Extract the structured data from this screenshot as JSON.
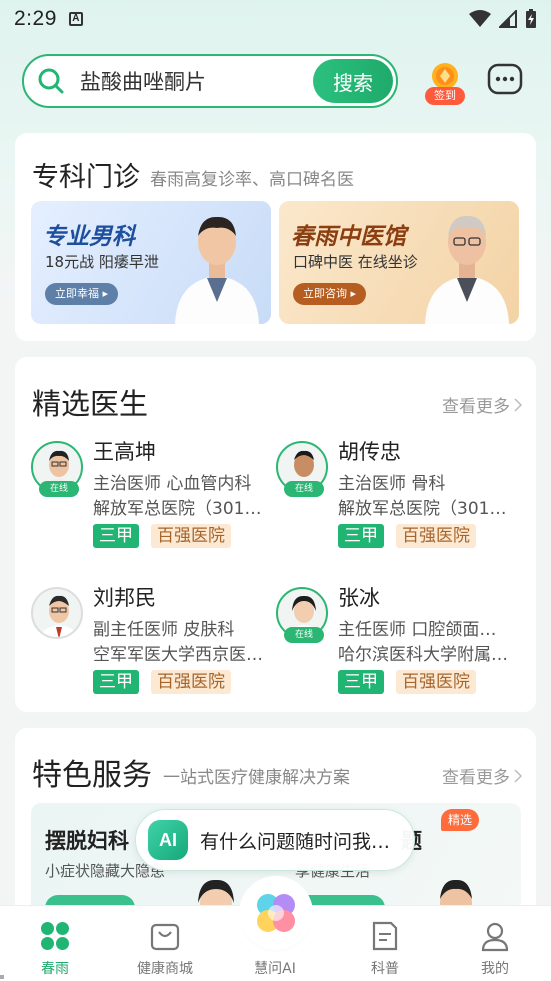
{
  "status_bar": {
    "time": "2:29"
  },
  "search": {
    "query": "盐酸曲唑酮片",
    "button_label": "搜索"
  },
  "header": {
    "checkin_label": "签到"
  },
  "specialty": {
    "title": "专科门诊",
    "subtitle": "春雨高复诊率、高口碑名医",
    "banners": [
      {
        "title": "专业男科",
        "subtitle": "18元战 阳痿早泄",
        "button": "立即幸福 ▸"
      },
      {
        "title": "春雨中医馆",
        "subtitle": "口碑中医 在线坐诊",
        "button": "立即咨询 ▸"
      }
    ]
  },
  "doctors": {
    "title": "精选医生",
    "more_label": "查看更多",
    "online_label": "在线",
    "list": [
      {
        "name": "王高坤",
        "title": "主治医师 心血管内科",
        "hospital": "解放军总医院（301…",
        "tag1": "三甲",
        "tag2": "百强医院",
        "online": true
      },
      {
        "name": "胡传忠",
        "title": "主治医师 骨科",
        "hospital": "解放军总医院（301…",
        "tag1": "三甲",
        "tag2": "百强医院",
        "online": true
      },
      {
        "name": "刘邦民",
        "title": "副主任医师 皮肤科",
        "hospital": "空军军医大学西京医…",
        "tag1": "三甲",
        "tag2": "百强医院",
        "online": false
      },
      {
        "name": "张冰",
        "title": "主任医师 口腔颌面…",
        "hospital": "哈尔滨医科大学附属…",
        "tag1": "三甲",
        "tag2": "百强医院",
        "online": true
      }
    ]
  },
  "services": {
    "title": "特色服务",
    "subtitle": "一站式医疗健康解决方案",
    "more_label": "查看更多",
    "item1_title": "摆脱妇科",
    "item1_sub": "小症状隐藏大隐患",
    "item2_title": "题",
    "item2_sub": "享健康生活",
    "hot_label": "精选"
  },
  "ai_prompt": {
    "text": "有什么问题随时问我…",
    "logo": "AI"
  },
  "tabbar": [
    {
      "label": "春雨",
      "icon": "clover-icon",
      "active": true
    },
    {
      "label": "健康商城",
      "icon": "shopping-bag-icon",
      "active": false
    },
    {
      "label": "慧问AI",
      "icon": "ai-orb-icon",
      "active": false
    },
    {
      "label": "科普",
      "icon": "article-icon",
      "active": false
    },
    {
      "label": "我的",
      "icon": "user-icon",
      "active": false
    }
  ],
  "colors": {
    "brand_green": "#21b574",
    "accent_orange": "#ff5a3c",
    "tag_beige": "#fbe9d3"
  }
}
